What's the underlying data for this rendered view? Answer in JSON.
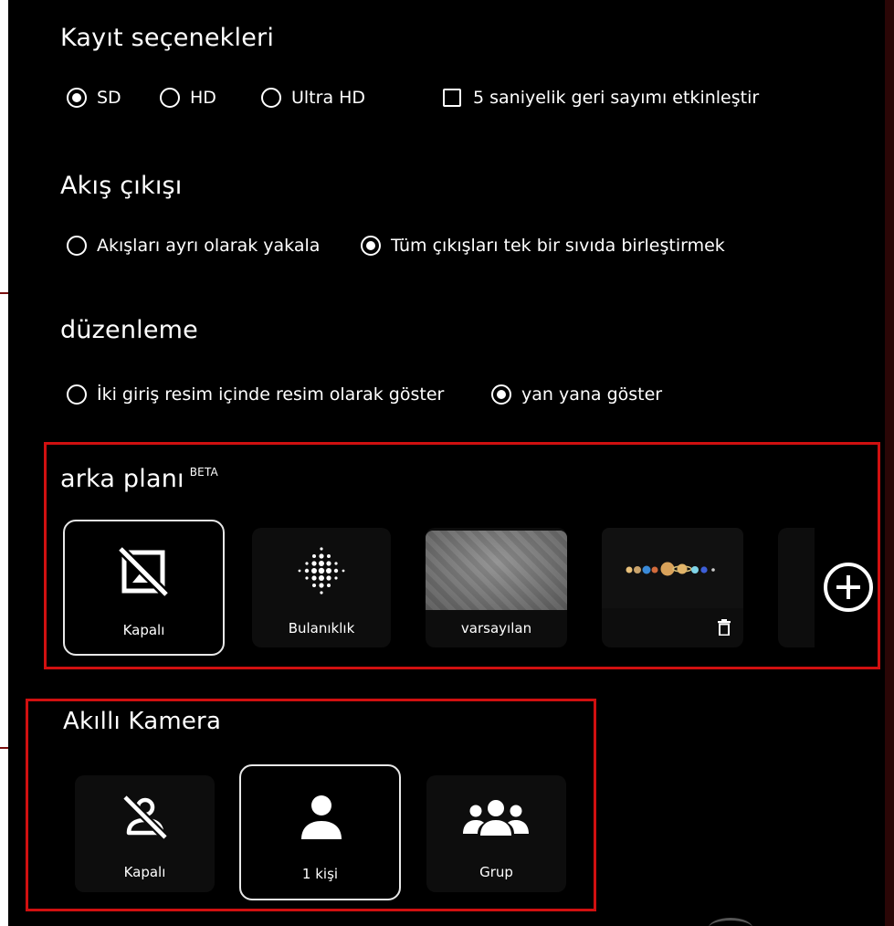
{
  "recording": {
    "title": "Kayıt seçenekleri",
    "quality_options": [
      {
        "label": "SD",
        "selected": true
      },
      {
        "label": "HD",
        "selected": false
      },
      {
        "label": "Ultra HD",
        "selected": false
      }
    ],
    "countdown_label": "5 saniyelik geri sayımı etkinleştir",
    "countdown_checked": false
  },
  "stream_output": {
    "title": "Akış çıkışı",
    "options": [
      {
        "label": "Akışları ayrı olarak yakala",
        "selected": false
      },
      {
        "label": "Tüm çıkışları tek bir sıvıda birleştirmek",
        "selected": true
      }
    ]
  },
  "layout": {
    "title": "düzenleme",
    "options": [
      {
        "label": "İki giriş resim içinde resim olarak göster",
        "selected": false
      },
      {
        "label": "yan yana göster",
        "selected": true
      }
    ]
  },
  "background": {
    "title": "arka planı",
    "badge": "BETA",
    "items": [
      {
        "label": "Kapalı",
        "icon": "image-off-icon",
        "selected": true
      },
      {
        "label": "Bulanıklık",
        "icon": "blur-icon",
        "selected": false
      },
      {
        "label": "varsayılan",
        "icon": "texture-thumbnail",
        "selected": false
      },
      {
        "label": "",
        "icon": "planets-thumbnail",
        "selected": false
      }
    ]
  },
  "smart_camera": {
    "title": "Akıllı Kamera",
    "items": [
      {
        "label": "Kapalı",
        "icon": "person-off-icon",
        "selected": false
      },
      {
        "label": "1 kişi",
        "icon": "person-icon",
        "selected": true
      },
      {
        "label": "Grup",
        "icon": "group-icon",
        "selected": false
      }
    ]
  },
  "colors": {
    "background": "#000000",
    "highlight_box": "#d01010",
    "text": "#ffffff"
  }
}
